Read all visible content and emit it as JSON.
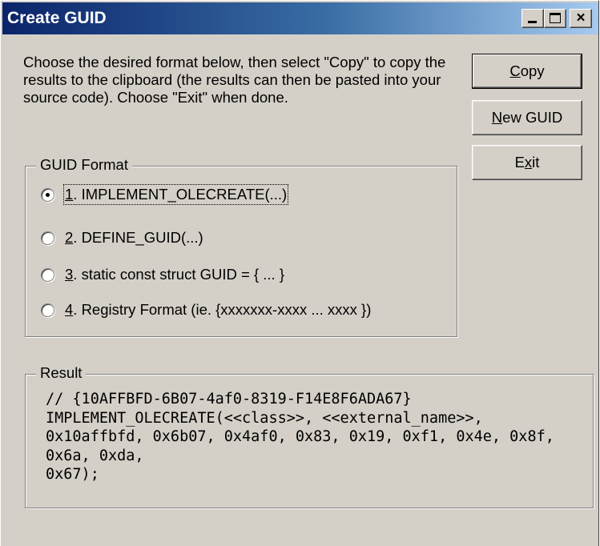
{
  "window": {
    "title": "Create GUID"
  },
  "title_buttons": {
    "close_glyph": "×"
  },
  "instructions": "Choose the desired format below, then select \"Copy\" to copy the results to the clipboard (the results can then be pasted into your source code).  Choose \"Exit\" when done.",
  "buttons": {
    "copy": {
      "mnemonic": "C",
      "rest": "opy"
    },
    "new_guid": {
      "mnemonic": "N",
      "rest": "ew GUID"
    },
    "exit": {
      "pre": "E",
      "mnemonic": "x",
      "rest": "it"
    }
  },
  "guid_format": {
    "legend": "GUID Format",
    "selected_index": 0,
    "options": [
      {
        "num": "1",
        "text": ". IMPLEMENT_OLECREATE(...)"
      },
      {
        "num": "2",
        "text": ". DEFINE_GUID(...)"
      },
      {
        "num": "3",
        "text": ". static const struct GUID = { ... }"
      },
      {
        "num": "4",
        "text": ". Registry Format (ie. {xxxxxxx-xxxx ... xxxx })"
      }
    ]
  },
  "result": {
    "legend": "Result",
    "text": "// {10AFFBFD-6B07-4af0-8319-F14E8F6ADA67}\nIMPLEMENT_OLECREATE(<<class>>, <<external_name>>,\n0x10affbfd, 0x6b07, 0x4af0, 0x83, 0x19, 0xf1, 0x4e, 0x8f, 0x6a, 0xda,\n0x67);"
  }
}
